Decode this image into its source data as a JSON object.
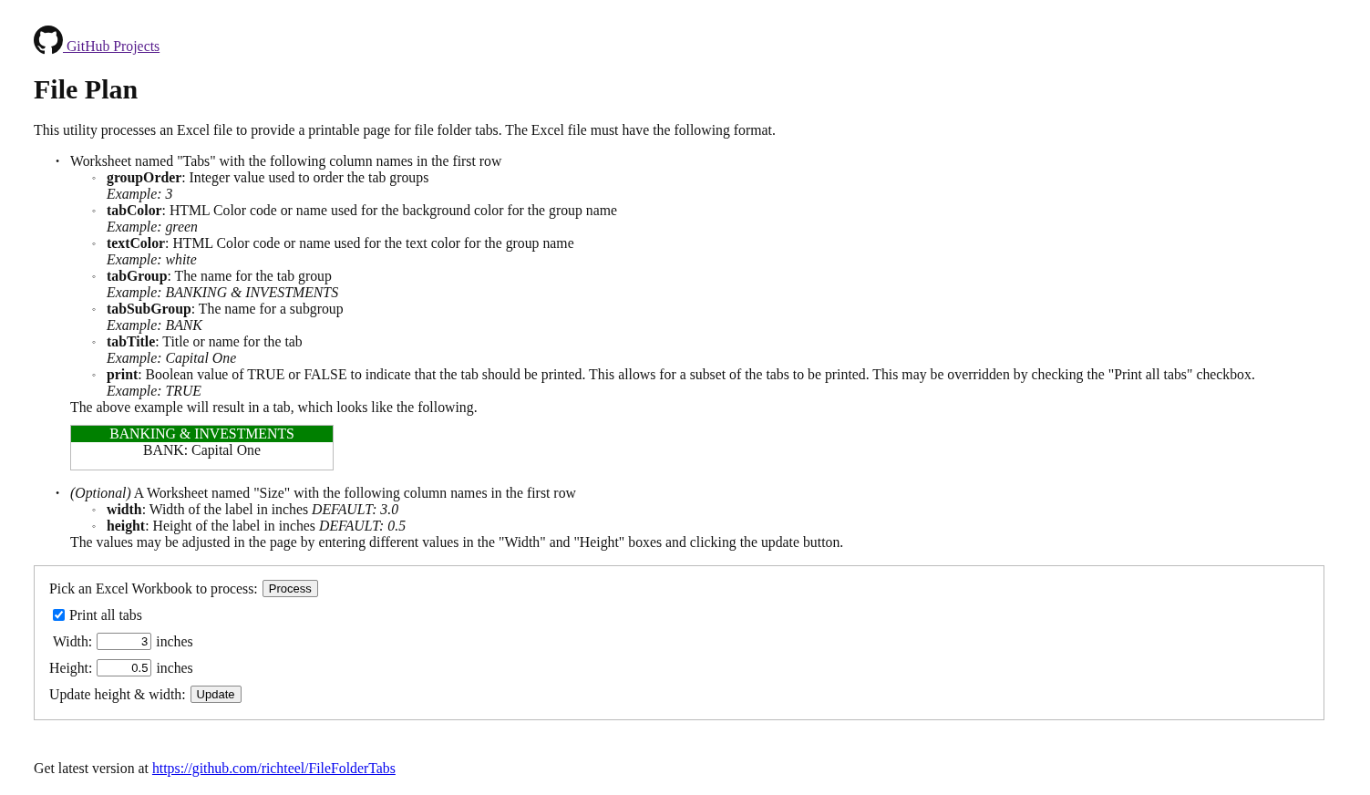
{
  "header": {
    "link": "GitHub Projects"
  },
  "title": "File Plan",
  "intro": "This utility processes an Excel file to provide a printable page for file folder tabs. The Excel file must have the following format.",
  "sections": [
    {
      "marker": "•",
      "lead": "Worksheet named \"Tabs\" with the following column names in the first row",
      "fields": [
        {
          "marker": "◦",
          "text": "**groupOrder**: Integer value used to order the tab groups",
          "example": "Example: 3"
        },
        {
          "marker": "◦",
          "text": "**tabColor**: HTML Color code or name used for the background color for the group name",
          "example": "Example: green"
        },
        {
          "marker": "◦",
          "text": "**textColor**: HTML Color code or name used for the text color for the group name",
          "example": "Example: white"
        },
        {
          "marker": "◦",
          "text": "**tabGroup**: The name for the tab group",
          "example": "Example: BANKING & INVESTMENTS"
        },
        {
          "marker": "◦",
          "text": "**tabSubGroup**: The name for a subgroup",
          "example": "Example: BANK"
        },
        {
          "marker": "◦",
          "text": "**tabTitle**: Title or name for the tab",
          "example": "Example: Capital One"
        },
        {
          "marker": "◦",
          "text": "**print**: Boolean value of TRUE or FALSE to indicate that the tab should be printed. This allows for a subset of the tabs to be printed. This may be overridden by checking the \"Print all tabs\" checkbox.",
          "example": "Example: TRUE"
        }
      ],
      "note": "The above example will result in a tab, which looks like the following.",
      "sample": {
        "group": "BANKING & INVESTMENTS",
        "title": "BANK: Capital One",
        "color": "#008000"
      }
    },
    {
      "marker": "•",
      "lead": "*(Optional)* A Worksheet named \"Size\" with the following column names in the first row",
      "fields": [
        {
          "marker": "◦",
          "text": "**width**: Width of the label in inches *DEFAULT: 3.0*"
        },
        {
          "marker": "◦",
          "text": "**height**: Height of the label in inches *DEFAULT: 0.5*"
        }
      ],
      "note": "The values may be adjusted in the page by entering different values in the \"Width\" and \"Height\" boxes and clicking the update button."
    }
  ],
  "form": {
    "pick_label": "Pick an Excel Workbook to process:",
    "process_button": "Process",
    "print_all": {
      "label": "Print all tabs",
      "checked": true
    },
    "width": {
      "label": "Width:",
      "value": "3",
      "unit": "inches"
    },
    "height": {
      "label": "Height:",
      "value": "0.5",
      "unit": "inches"
    },
    "update_label": "Update height & width:",
    "update_button": "Update"
  },
  "footer": {
    "text": "Get latest version at",
    "link": "https://github.com/richteel/FileFolderTabs"
  }
}
